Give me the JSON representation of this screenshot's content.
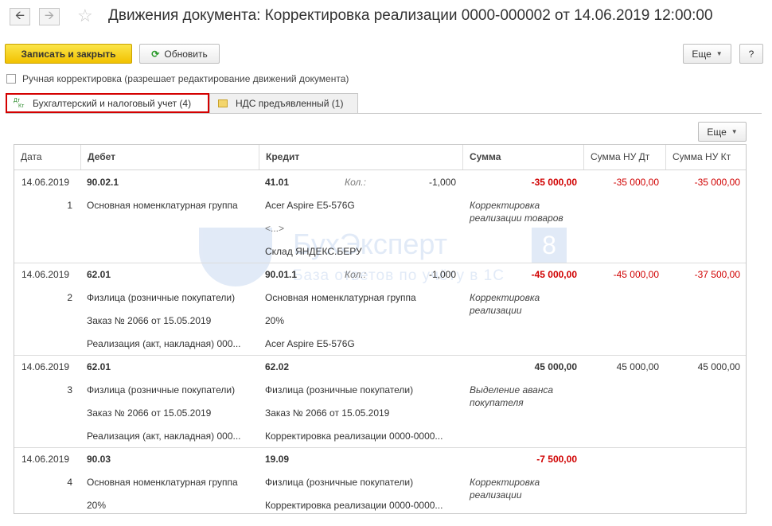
{
  "window": {
    "title": "Движения документа: Корректировка реализации 0000-000002 от 14.06.2019 12:00:00",
    "back_icon": "arrow-left-icon",
    "forward_icon": "arrow-right-icon",
    "favorite_icon": "star-icon"
  },
  "toolbar": {
    "save_close": "Записать и закрыть",
    "refresh": "Обновить",
    "more": "Еще",
    "help": "?"
  },
  "manual": {
    "label": "Ручная корректировка (разрешает редактирование движений документа)",
    "checked": false
  },
  "tabs": [
    {
      "icon_dt": "Дт",
      "icon_kt": "Кт",
      "label": "Бухгалтерский и налоговый учет (4)",
      "active": true
    },
    {
      "label": "НДС предъявленный (1)",
      "active": false
    }
  ],
  "table_toolbar": {
    "more": "Еще"
  },
  "columns": {
    "date": "Дата",
    "debit": "Дебет",
    "credit": "Кредит",
    "sum": "Сумма",
    "nu_dt": "Сумма НУ Дт",
    "nu_kt": "Сумма НУ Кт"
  },
  "rows": [
    {
      "date": "14.06.2019",
      "num": "1",
      "debit_account": "90.02.1",
      "debit_lines": [
        "Основная номенклатурная группа",
        "",
        ""
      ],
      "credit_account": "41.01",
      "qty_label": "Кол.:",
      "qty": "-1,000",
      "credit_lines": [
        "Acer Aspire E5-576G",
        "<...>",
        "Склад ЯНДЕКС.БЕРУ"
      ],
      "sum": "-35 000,00",
      "sum_red": true,
      "comment": [
        "Корректировка",
        "реализации товаров"
      ],
      "nu_dt": "-35 000,00",
      "nu_kt": "-35 000,00"
    },
    {
      "date": "14.06.2019",
      "num": "2",
      "debit_account": "62.01",
      "debit_lines": [
        "Физлица (розничные покупатели)",
        "Заказ № 2066 от 15.05.2019",
        "Реализация (акт, накладная) 000..."
      ],
      "credit_account": "90.01.1",
      "qty_label": "Кол.:",
      "qty": "-1,000",
      "credit_lines": [
        "Основная номенклатурная группа",
        "20%",
        "Acer Aspire E5-576G"
      ],
      "sum": "-45 000,00",
      "sum_red": true,
      "comment": [
        "Корректировка",
        "реализации"
      ],
      "nu_dt": "-45 000,00",
      "nu_kt": "-37 500,00"
    },
    {
      "date": "14.06.2019",
      "num": "3",
      "debit_account": "62.01",
      "debit_lines": [
        "Физлица (розничные покупатели)",
        "Заказ № 2066 от 15.05.2019",
        "Реализация (акт, накладная) 000..."
      ],
      "credit_account": "62.02",
      "qty_label": "",
      "qty": "",
      "credit_lines": [
        "Физлица (розничные покупатели)",
        "Заказ № 2066 от 15.05.2019",
        "Корректировка реализации 0000-0000..."
      ],
      "sum": "45 000,00",
      "sum_red": false,
      "comment": [
        "Выделение аванса",
        "покупателя"
      ],
      "nu_dt": "45 000,00",
      "nu_kt": "45 000,00"
    },
    {
      "date": "14.06.2019",
      "num": "4",
      "debit_account": "90.03",
      "debit_lines": [
        "Основная номенклатурная группа",
        "20%",
        ""
      ],
      "credit_account": "19.09",
      "qty_label": "",
      "qty": "",
      "credit_lines": [
        "Физлица (розничные покупатели)",
        "Корректировка реализации 0000-0000...",
        ""
      ],
      "sum": "-7 500,00",
      "sum_red": true,
      "comment": [
        "Корректировка",
        "реализации"
      ],
      "nu_dt": "",
      "nu_kt": ""
    }
  ],
  "watermark": {
    "name": "БухЭксперт",
    "number": "8",
    "subtitle": "База ответов по учёту в 1С"
  }
}
